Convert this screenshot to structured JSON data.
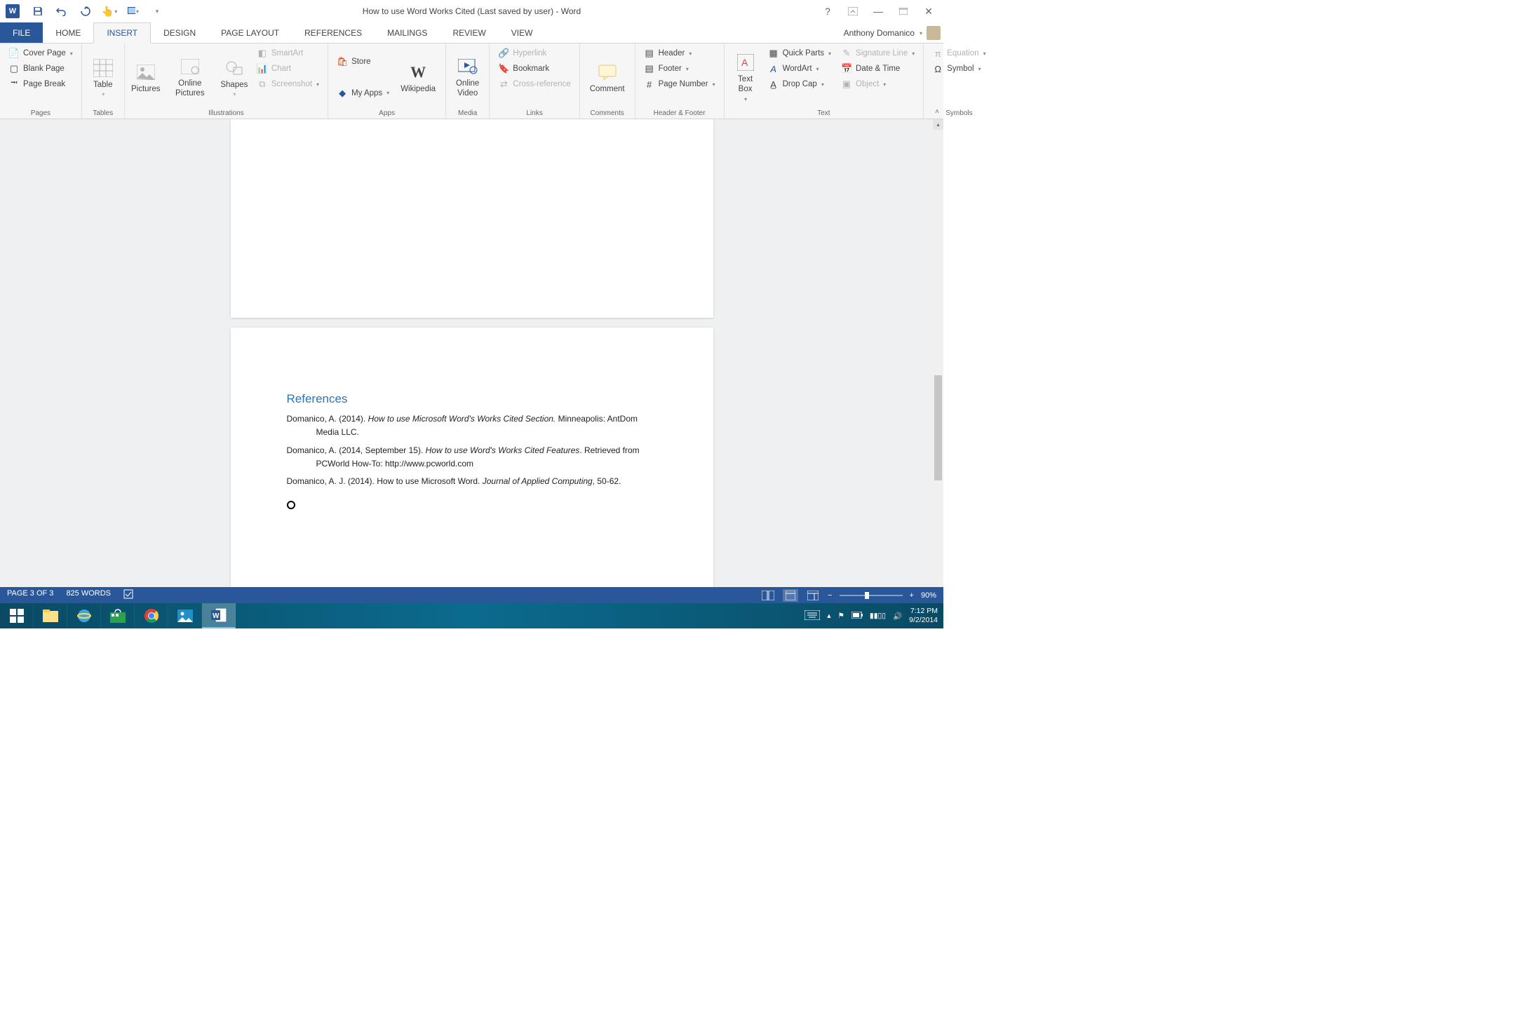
{
  "title": "How to use Word Works Cited (Last saved by user) - Word",
  "user": "Anthony Domanico",
  "tabs": {
    "file": "FILE",
    "home": "HOME",
    "insert": "INSERT",
    "design": "DESIGN",
    "page_layout": "PAGE LAYOUT",
    "references": "REFERENCES",
    "mailings": "MAILINGS",
    "review": "REVIEW",
    "view": "VIEW"
  },
  "ribbon": {
    "pages": {
      "label": "Pages",
      "cover_page": "Cover Page",
      "blank_page": "Blank Page",
      "page_break": "Page Break"
    },
    "tables": {
      "label": "Tables",
      "table": "Table"
    },
    "illustrations": {
      "label": "Illustrations",
      "pictures": "Pictures",
      "online_pictures": "Online Pictures",
      "shapes": "Shapes",
      "smartart": "SmartArt",
      "chart": "Chart",
      "screenshot": "Screenshot"
    },
    "apps": {
      "label": "Apps",
      "store": "Store",
      "my_apps": "My Apps",
      "wikipedia": "Wikipedia"
    },
    "media": {
      "label": "Media",
      "online_video": "Online Video"
    },
    "links": {
      "label": "Links",
      "hyperlink": "Hyperlink",
      "bookmark": "Bookmark",
      "cross_reference": "Cross-reference"
    },
    "comments": {
      "label": "Comments",
      "comment": "Comment"
    },
    "header_footer": {
      "label": "Header & Footer",
      "header": "Header",
      "footer": "Footer",
      "page_number": "Page Number"
    },
    "text": {
      "label": "Text",
      "text_box": "Text Box",
      "quick_parts": "Quick Parts",
      "wordart": "WordArt",
      "drop_cap": "Drop Cap",
      "signature_line": "Signature Line",
      "date_time": "Date & Time",
      "object": "Object"
    },
    "symbols": {
      "label": "Symbols",
      "equation": "Equation",
      "symbol": "Symbol"
    }
  },
  "doc": {
    "ref_heading": "References",
    "entries": [
      {
        "a": "Domanico, A. (2014). ",
        "i": "How to use Microsoft Word's Works Cited Section.",
        "b": " Minneapolis: AntDom Media LLC."
      },
      {
        "a": "Domanico, A. (2014, September 15). ",
        "i": "How to use Word's Works Cited Features",
        "b": ". Retrieved from PCWorld How-To: http://www.pcworld.com"
      },
      {
        "a": "Domanico, A. J. (2014). How to use Microsoft Word. ",
        "i": "Journal of Applied Computing",
        "b": ", 50-62."
      }
    ]
  },
  "status": {
    "page": "PAGE 3 OF 3",
    "words": "825 WORDS",
    "zoom": "90%"
  },
  "tray": {
    "time": "7:12 PM",
    "date": "9/2/2014"
  }
}
